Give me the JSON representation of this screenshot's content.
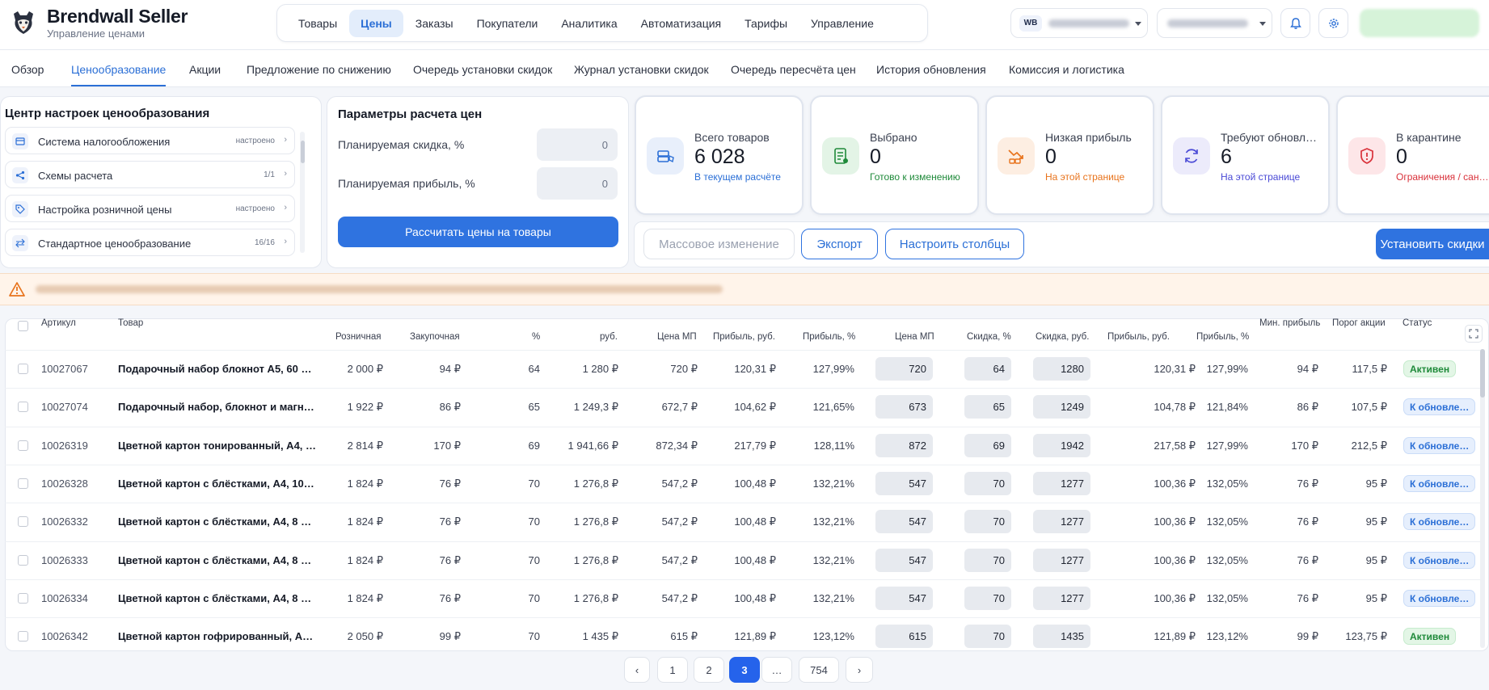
{
  "brand": {
    "title": "Brendwall Seller",
    "subtitle": "Управление ценами"
  },
  "main_nav": [
    "Товары",
    "Цены",
    "Заказы",
    "Покупатели",
    "Аналитика",
    "Автоматизация",
    "Тарифы",
    "Управление"
  ],
  "main_nav_active": "Цены",
  "marketplace": {
    "badge": "WB"
  },
  "sub_nav": [
    "Обзор",
    "Ценообразование",
    "Акции",
    "Предложение по снижению",
    "Очередь установки скидок",
    "Журнал установки скидок",
    "Очередь пересчёта цен",
    "История обновления",
    "Комиссия и логистика"
  ],
  "sub_nav_active": "Ценообразование",
  "settings": {
    "title": "Центр настроек ценообразования",
    "items": [
      {
        "label": "Система налогообложения",
        "status": "настроено",
        "icon": "tax-icon"
      },
      {
        "label": "Схемы расчета",
        "status": "1/1",
        "icon": "scheme-icon"
      },
      {
        "label": "Настройка розничной цены",
        "status": "настроено",
        "icon": "tag-icon"
      },
      {
        "label": "Стандартное ценообразование",
        "status": "16/16",
        "icon": "arrows-icon"
      }
    ]
  },
  "params": {
    "title": "Параметры расчета цен",
    "discount_label": "Планируемая скидка, %",
    "discount_value": "0",
    "profit_label": "Планируемая прибыль, %",
    "profit_value": "0",
    "calc_button": "Рассчитать цены на товары"
  },
  "stats": [
    {
      "title": "Всего товаров",
      "value": "6 028",
      "sub": "В текущем расчёте",
      "color": "#2b6fd6",
      "icon": "boxes-icon",
      "bg": "#e8effb"
    },
    {
      "title": "Выбрано",
      "value": "0",
      "sub": "Готово к изменению",
      "color": "#1f8a3a",
      "icon": "document-edit-icon",
      "bg": "#e3f4e6"
    },
    {
      "title": "Низкая прибыль",
      "value": "0",
      "sub": "На этой странице",
      "color": "#e8731c",
      "icon": "chart-down-icon",
      "bg": "#fdeee2"
    },
    {
      "title": "Требуют обновл…",
      "value": "6",
      "sub": "На этой странице",
      "color": "#4a4ad6",
      "icon": "refresh-icon",
      "bg": "#ecebfb"
    },
    {
      "title": "В карантине",
      "value": "0",
      "sub": "Ограничения / сан…",
      "color": "#d9313a",
      "icon": "shield-alert-icon",
      "bg": "#fde6e8"
    }
  ],
  "actions": {
    "mass_change": "Массовое изменение",
    "export": "Экспорт",
    "columns": "Настроить столбцы",
    "set_discounts": "Установить скидки"
  },
  "table": {
    "headers": {
      "article": "Артикул",
      "product": "Товар",
      "retail": "Розничная",
      "purchase": "Закупочная",
      "pct": "%",
      "rub": "руб.",
      "mp_price": "Цена МП",
      "profit_rub": "Прибыль, руб.",
      "profit_pct": "Прибыль, %",
      "new_mp_price": "Цена МП",
      "discount_pct": "Скидка, %",
      "discount_rub": "Скидка, руб.",
      "new_profit_rub": "Прибыль, руб.",
      "new_profit_pct": "Прибыль, %",
      "min_profit": "Мин. прибыль",
      "threshold": "Порог акции",
      "status": "Статус"
    },
    "rows": [
      {
        "article": "10027067",
        "name": "Подарочный набор блокнот А5, 60 …",
        "retail": "2 000 ₽",
        "purchase": "94 ₽",
        "pct": "64",
        "rub": "1 280 ₽",
        "mp": "720 ₽",
        "profit": "120,31 ₽",
        "profit_pct": "127,99%",
        "new_mp": "720",
        "disc_pct": "64",
        "disc_rub": "1280",
        "new_profit": "120,31 ₽",
        "new_profit_pct": "127,99%",
        "min_profit": "94 ₽",
        "threshold": "117,5 ₽",
        "status": "Активен",
        "status_type": "active"
      },
      {
        "article": "10027074",
        "name": "Подарочный набор, блокнот и магн…",
        "retail": "1 922 ₽",
        "purchase": "86 ₽",
        "pct": "65",
        "rub": "1 249,3 ₽",
        "mp": "672,7 ₽",
        "profit": "104,62 ₽",
        "profit_pct": "121,65%",
        "new_mp": "673",
        "disc_pct": "65",
        "disc_rub": "1249",
        "new_profit": "104,78 ₽",
        "new_profit_pct": "121,84%",
        "min_profit": "86 ₽",
        "threshold": "107,5 ₽",
        "status": "К обновле…",
        "status_type": "pending"
      },
      {
        "article": "10026319",
        "name": "Цветной картон тонированный, А4, …",
        "retail": "2 814 ₽",
        "purchase": "170 ₽",
        "pct": "69",
        "rub": "1 941,66 ₽",
        "mp": "872,34 ₽",
        "profit": "217,79 ₽",
        "profit_pct": "128,11%",
        "new_mp": "872",
        "disc_pct": "69",
        "disc_rub": "1942",
        "new_profit": "217,58 ₽",
        "new_profit_pct": "127,99%",
        "min_profit": "170 ₽",
        "threshold": "212,5 ₽",
        "status": "К обновле…",
        "status_type": "pending"
      },
      {
        "article": "10026328",
        "name": "Цветной картон с блёстками, А4, 10…",
        "retail": "1 824 ₽",
        "purchase": "76 ₽",
        "pct": "70",
        "rub": "1 276,8 ₽",
        "mp": "547,2 ₽",
        "profit": "100,48 ₽",
        "profit_pct": "132,21%",
        "new_mp": "547",
        "disc_pct": "70",
        "disc_rub": "1277",
        "new_profit": "100,36 ₽",
        "new_profit_pct": "132,05%",
        "min_profit": "76 ₽",
        "threshold": "95 ₽",
        "status": "К обновле…",
        "status_type": "pending"
      },
      {
        "article": "10026332",
        "name": "Цветной картон с блёстками, А4, 8 …",
        "retail": "1 824 ₽",
        "purchase": "76 ₽",
        "pct": "70",
        "rub": "1 276,8 ₽",
        "mp": "547,2 ₽",
        "profit": "100,48 ₽",
        "profit_pct": "132,21%",
        "new_mp": "547",
        "disc_pct": "70",
        "disc_rub": "1277",
        "new_profit": "100,36 ₽",
        "new_profit_pct": "132,05%",
        "min_profit": "76 ₽",
        "threshold": "95 ₽",
        "status": "К обновле…",
        "status_type": "pending"
      },
      {
        "article": "10026333",
        "name": "Цветной картон с блёстками, А4, 8 …",
        "retail": "1 824 ₽",
        "purchase": "76 ₽",
        "pct": "70",
        "rub": "1 276,8 ₽",
        "mp": "547,2 ₽",
        "profit": "100,48 ₽",
        "profit_pct": "132,21%",
        "new_mp": "547",
        "disc_pct": "70",
        "disc_rub": "1277",
        "new_profit": "100,36 ₽",
        "new_profit_pct": "132,05%",
        "min_profit": "76 ₽",
        "threshold": "95 ₽",
        "status": "К обновле…",
        "status_type": "pending"
      },
      {
        "article": "10026334",
        "name": "Цветной картон с блёстками, А4, 8 …",
        "retail": "1 824 ₽",
        "purchase": "76 ₽",
        "pct": "70",
        "rub": "1 276,8 ₽",
        "mp": "547,2 ₽",
        "profit": "100,48 ₽",
        "profit_pct": "132,21%",
        "new_mp": "547",
        "disc_pct": "70",
        "disc_rub": "1277",
        "new_profit": "100,36 ₽",
        "new_profit_pct": "132,05%",
        "min_profit": "76 ₽",
        "threshold": "95 ₽",
        "status": "К обновле…",
        "status_type": "pending"
      },
      {
        "article": "10026342",
        "name": "Цветной картон гофрированный, А…",
        "retail": "2 050 ₽",
        "purchase": "99 ₽",
        "pct": "70",
        "rub": "1 435 ₽",
        "mp": "615 ₽",
        "profit": "121,89 ₽",
        "profit_pct": "123,12%",
        "new_mp": "615",
        "disc_pct": "70",
        "disc_rub": "1435",
        "new_profit": "121,89 ₽",
        "new_profit_pct": "123,12%",
        "min_profit": "99 ₽",
        "threshold": "123,75 ₽",
        "status": "Активен",
        "status_type": "active"
      }
    ]
  },
  "pagination": {
    "pages": [
      "‹",
      "1",
      "2",
      "3",
      "…",
      "754",
      "›"
    ],
    "current": "3"
  }
}
